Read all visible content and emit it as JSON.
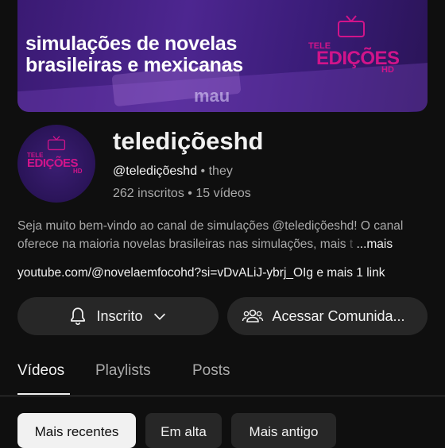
{
  "banner": {
    "headline_line1": "simulações de novelas",
    "headline_line2": "brasileiras e mexicanas",
    "bg_word": "mau"
  },
  "logo": {
    "tele": "TELE",
    "edicoes": "EDIÇÕES",
    "hd": "HD"
  },
  "channel": {
    "name": "telediçõeshd",
    "handle": "@telediçõeshd",
    "separator": "•",
    "pronouns": "they",
    "subscribers": "262 inscritos",
    "videos": "15 vídeos"
  },
  "description": {
    "line1": "Seja muito bem-vindo ao canal de simulações @telediçõeshd! O canal",
    "line2": "oferece na maioria novelas brasileiras nas simulações, mais",
    "line2_fade": "t",
    "more": "...mais"
  },
  "links": {
    "url": "youtube.com/@novelaemfocohd?si=vDvALiJ-ybrj_OIg",
    "extra": "e mais 1 link"
  },
  "buttons": {
    "subscribed": "Inscrito",
    "community": "Acessar Comunida..."
  },
  "tabs": [
    {
      "label": "Vídeos",
      "active": true
    },
    {
      "label": "Playlists",
      "active": false
    },
    {
      "label": "Posts",
      "active": false
    }
  ],
  "chips": [
    {
      "label": "Mais recentes",
      "active": true
    },
    {
      "label": "Em alta",
      "active": false
    },
    {
      "label": "Mais antigo",
      "active": false
    }
  ],
  "colors": {
    "background": "#0f0f0f",
    "brand_pink": "#d1148a",
    "banner_purple": "#4d2690"
  },
  "icons": [
    "bell-icon",
    "chevron-down-icon",
    "people-icon",
    "tv-icon"
  ]
}
